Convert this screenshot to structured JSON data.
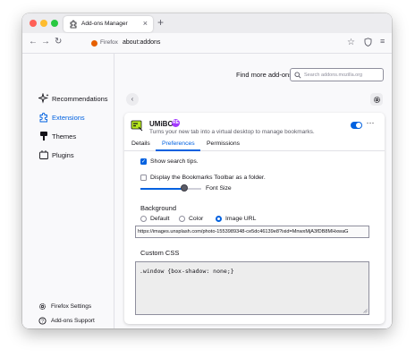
{
  "browser": {
    "tab_title": "Add-ons Manager",
    "tab_close_glyph": "×",
    "new_tab_glyph": "+",
    "url_identity": "Firefox",
    "url": "about:addons",
    "nav_back": "←",
    "nav_forward": "→",
    "nav_reload": "↻",
    "bookmark_star": "☆",
    "menu_glyph": "≡"
  },
  "sidebar": {
    "categories": [
      {
        "label": "Recommendations",
        "icon": "sparkle-icon"
      },
      {
        "label": "Extensions",
        "icon": "puzzle-icon",
        "active": true
      },
      {
        "label": "Themes",
        "icon": "brush-icon"
      },
      {
        "label": "Plugins",
        "icon": "plugin-icon"
      }
    ],
    "footer": [
      {
        "label": "Firefox Settings",
        "icon": "gear-icon"
      },
      {
        "label": "Add-ons Support",
        "icon": "help-icon"
      }
    ]
  },
  "header": {
    "find_label": "Find more add-ons",
    "search_placeholder": "Search addons.mozilla.org"
  },
  "addon": {
    "name": "UMiBO",
    "badge": "RE",
    "description": "Turns your new tab into a virtual desktop to manage bookmarks.",
    "enabled": true,
    "more_glyph": "···",
    "tabs": [
      "Details",
      "Preferences",
      "Permissions"
    ],
    "active_tab": "Preferences"
  },
  "preferences": {
    "show_search_tips": {
      "label": "Show search tips.",
      "checked": true
    },
    "bookmarks_toolbar": {
      "label": "Display the Bookmarks Toolbar as a folder.",
      "checked": false
    },
    "font_size": {
      "label": "Font Size",
      "value_fraction": 0.72
    },
    "background_heading": "Background",
    "background_options": [
      "Default",
      "Color",
      "Image URL"
    ],
    "background_selected": "Image URL",
    "image_url": "https://images.unsplash.com/photo-1553989348-ce5dc46139e8?ixid=MnwxMjA3fDB8MHxwaG",
    "custom_css_heading": "Custom CSS",
    "custom_css": ".window {box-shadow: none;}"
  },
  "colors": {
    "accent": "#0061e0",
    "badge": "#a238ff",
    "close": "#ff5f57",
    "minimize": "#febc2e",
    "maximize": "#28c840"
  }
}
